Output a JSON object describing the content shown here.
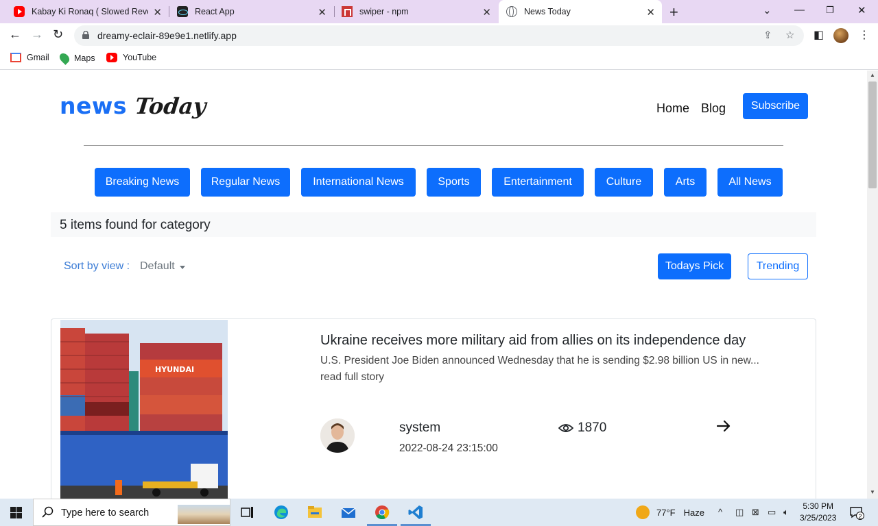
{
  "browser": {
    "tabs": [
      {
        "title": "Kabay Ki Ronaq ( Slowed Reverb",
        "icon": "youtube-icon"
      },
      {
        "title": "React App",
        "icon": "react-icon"
      },
      {
        "title": "swiper - npm",
        "icon": "npm-icon"
      },
      {
        "title": "News Today",
        "icon": "globe-icon"
      }
    ],
    "url": "dreamy-eclair-89e9e1.netlify.app",
    "bookmarks": [
      "Gmail",
      "Maps",
      "YouTube"
    ]
  },
  "site": {
    "logo_a": "news",
    "logo_b": "Today",
    "nav": [
      "Home",
      "Blog"
    ],
    "subscribe": "Subscribe",
    "categories": [
      "Breaking News",
      "Regular News",
      "International News",
      "Sports",
      "Entertainment",
      "Culture",
      "Arts",
      "All News"
    ],
    "found_text": "5 items found for category",
    "sort_label": "Sort by view :",
    "sort_value": "Default",
    "todays_pick": "Todays Pick",
    "trending": "Trending",
    "accent": "#0d6efd"
  },
  "article": {
    "title": "Ukraine receives more military aid from allies on its independence day",
    "description": "U.S. President Joe Biden announced Wednesday that he is sending $2.98 billion US in new...",
    "read_more": "read full story",
    "author": "system",
    "date": "2022-08-24 23:15:00",
    "views": "1870"
  },
  "taskbar": {
    "search_placeholder": "Type here to search",
    "temperature": "77°F",
    "weather": "Haze",
    "time": "5:30 PM",
    "date": "3/25/2023",
    "notifications": "2"
  }
}
